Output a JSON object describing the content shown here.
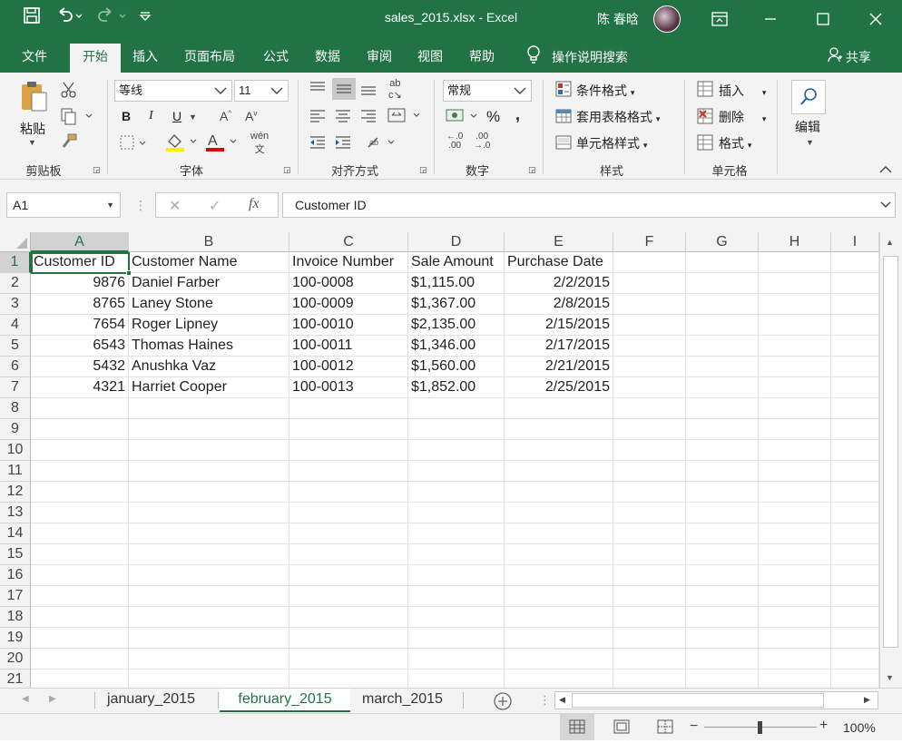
{
  "window": {
    "title": "sales_2015.xlsx  -  Excel",
    "user_name": "陈 春晗"
  },
  "tabs": [
    {
      "label": "文件"
    },
    {
      "label": "开始"
    },
    {
      "label": "插入"
    },
    {
      "label": "页面布局"
    },
    {
      "label": "公式"
    },
    {
      "label": "数据"
    },
    {
      "label": "审阅"
    },
    {
      "label": "视图"
    },
    {
      "label": "帮助"
    }
  ],
  "tell_me": "操作说明搜索",
  "share": "共享",
  "ribbon": {
    "clipboard": {
      "paste": "粘贴",
      "label": "剪贴板"
    },
    "font": {
      "name": "等线",
      "size": "11",
      "label": "字体",
      "bold": "B",
      "italic": "I",
      "underline": "U"
    },
    "alignment": {
      "label": "对齐方式"
    },
    "number": {
      "format": "常规",
      "label": "数字",
      "percent": "%",
      "comma": ","
    },
    "styles": {
      "conditional": "条件格式",
      "table": "套用表格格式",
      "cell": "单元格样式",
      "label": "样式"
    },
    "cells": {
      "insert": "插入",
      "delete": "删除",
      "format": "格式",
      "label": "单元格"
    },
    "editing": {
      "label": "编辑"
    }
  },
  "formula_bar": {
    "name_box": "A1",
    "formula": "Customer ID",
    "fx": "fx"
  },
  "columns": [
    "A",
    "B",
    "C",
    "D",
    "E",
    "F",
    "G",
    "H",
    "I"
  ],
  "rows": [
    "1",
    "2",
    "3",
    "4",
    "5",
    "6",
    "7",
    "8",
    "9",
    "10",
    "11",
    "12",
    "13",
    "14",
    "15",
    "16",
    "17",
    "18",
    "19",
    "20",
    "21"
  ],
  "cells": [
    [
      "Customer ID",
      "Customer Name",
      "Invoice Number",
      "Sale Amount",
      "Purchase Date"
    ],
    [
      "9876",
      "Daniel Farber",
      "100-0008",
      "$1,115.00",
      "2/2/2015"
    ],
    [
      "8765",
      "Laney Stone",
      "100-0009",
      "$1,367.00",
      "2/8/2015"
    ],
    [
      "7654",
      "Roger Lipney",
      "100-0010",
      "$2,135.00",
      "2/15/2015"
    ],
    [
      "6543",
      "Thomas Haines",
      "100-0011",
      "$1,346.00",
      "2/17/2015"
    ],
    [
      "5432",
      "Anushka Vaz",
      "100-0012",
      "$1,560.00",
      "2/21/2015"
    ],
    [
      "4321",
      "Harriet Cooper",
      "100-0013",
      "$1,852.00",
      "2/25/2015"
    ]
  ],
  "sheets": [
    {
      "label": "january_2015"
    },
    {
      "label": "february_2015"
    },
    {
      "label": "march_2015"
    }
  ],
  "status": {
    "zoom": "100%"
  },
  "colors": {
    "brand": "#217346",
    "ribbon_bg": "#f3f3f3"
  }
}
